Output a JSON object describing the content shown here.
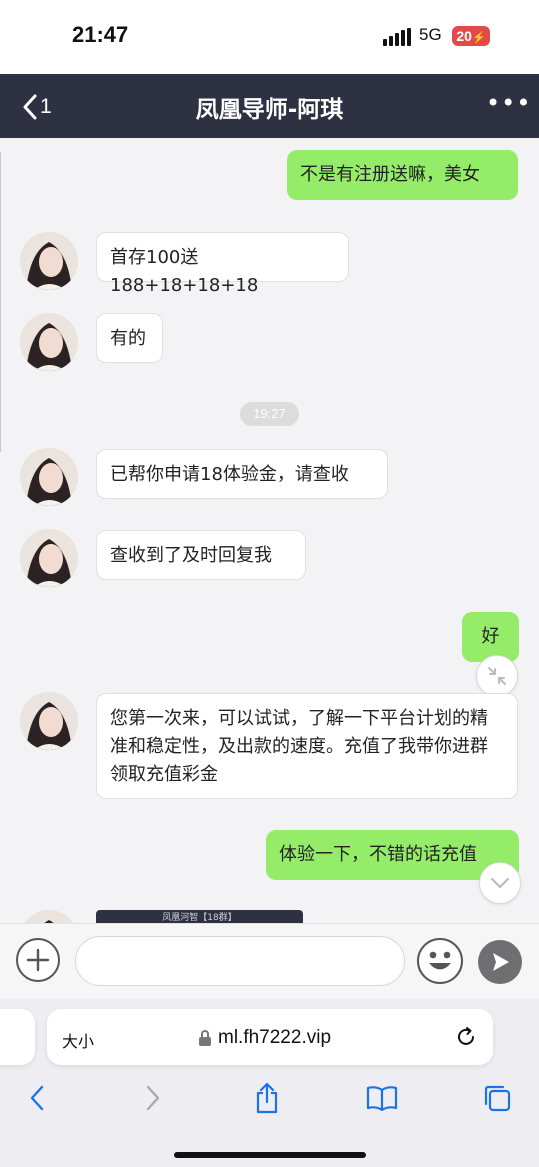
{
  "status_bar": {
    "time": "21:47",
    "network": "5G",
    "battery": "20"
  },
  "header": {
    "back_label": "1",
    "title": "凤凰导师-阿琪",
    "more_label": "•••"
  },
  "chat": {
    "messages": [
      {
        "side": "out",
        "text": "不是有注册送嘛，美女"
      },
      {
        "side": "in",
        "text": "首存100送188+18+18+18"
      },
      {
        "side": "in",
        "text": "有的"
      },
      {
        "side": "time",
        "text": "19:27"
      },
      {
        "side": "in",
        "text": "已帮你申请18体验金，请查收"
      },
      {
        "side": "in",
        "text": "查收到了及时回复我"
      },
      {
        "side": "out",
        "text": "好"
      },
      {
        "side": "in",
        "text": "您第一次来，可以试试，了解一下平台计划的精准和稳定性，及出款的速度。充值了我带你进群领取充值彩金"
      },
      {
        "side": "out",
        "text": "体验一下，不错的话充值"
      }
    ],
    "preview_card_title": "凤凰河智【18群】"
  },
  "input_bar": {
    "value": "",
    "placeholder": ""
  },
  "browser": {
    "text_size_label": "大小",
    "url": "ml.fh7222.vip"
  },
  "colors": {
    "navbar": "#2d3142",
    "outgoing_bubble": "#95ec69",
    "incoming_bubble": "#ffffff",
    "browser_accent": "#1a73e8",
    "battery": "#e24a4a"
  }
}
